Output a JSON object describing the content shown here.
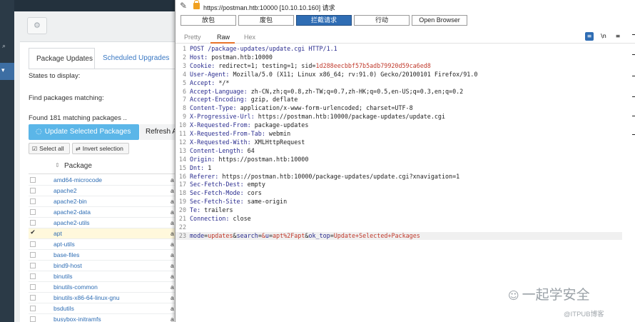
{
  "webmin": {
    "tabs": [
      "Package Updates",
      "Scheduled Upgrades"
    ],
    "states_label": "States to display:",
    "find_label": "Find packages matching:",
    "found_text": "Found 181 matching packages ..",
    "update_button": "Update Selected Packages",
    "refresh_button": "Refresh A",
    "select_all": "Select all",
    "invert_selection": "Invert selection",
    "column_header": "Package",
    "packages": [
      {
        "name": "amd64-microcode",
        "checked": false
      },
      {
        "name": "apache2",
        "checked": false
      },
      {
        "name": "apache2-bin",
        "checked": false
      },
      {
        "name": "apache2-data",
        "checked": false
      },
      {
        "name": "apache2-utils",
        "checked": false
      },
      {
        "name": "apt",
        "checked": true
      },
      {
        "name": "apt-utils",
        "checked": false
      },
      {
        "name": "base-files",
        "checked": false
      },
      {
        "name": "bind9-host",
        "checked": false
      },
      {
        "name": "binutils",
        "checked": false
      },
      {
        "name": "binutils-common",
        "checked": false
      },
      {
        "name": "binutils-x86-64-linux-gnu",
        "checked": false
      },
      {
        "name": "bsdutils",
        "checked": false
      },
      {
        "name": "busybox-initramfs",
        "checked": false
      }
    ],
    "row_tail": "a"
  },
  "burp": {
    "url": "https://postman.htb:10000  [10.10.10.160] 请求",
    "buttons": {
      "forward": "放包",
      "drop": "废包",
      "intercept": "拦截请求",
      "action": "行动",
      "open_browser": "Open Browser"
    },
    "view_tabs": [
      "Pretty",
      "Raw",
      "Hex"
    ],
    "active_view_tab": "Raw",
    "wrap_icon_label": "\\n",
    "menu_icon_label": "≡",
    "request_lines": [
      {
        "n": "1",
        "k": "POST /package-updates/update.cgi HTTP/1.1",
        "v": ""
      },
      {
        "n": "2",
        "k": "Host:",
        "v": " postman.htb:10000"
      },
      {
        "n": "3",
        "k": "Cookie:",
        "v": " redirect=1; testing=1; sid=",
        "s": "1d288eecbbf57b5adb79920d59ca6ed8"
      },
      {
        "n": "4",
        "k": "User-Agent:",
        "v": " Mozilla/5.0 (X11; Linux x86_64; rv:91.0) Gecko/20100101 Firefox/91.0"
      },
      {
        "n": "5",
        "k": "Accept:",
        "v": " */*"
      },
      {
        "n": "6",
        "k": "Accept-Language:",
        "v": " zh-CN,zh;q=0.8,zh-TW;q=0.7,zh-HK;q=0.5,en-US;q=0.3,en;q=0.2"
      },
      {
        "n": "7",
        "k": "Accept-Encoding:",
        "v": " gzip, deflate"
      },
      {
        "n": "8",
        "k": "Content-Type:",
        "v": " application/x-www-form-urlencoded; charset=UTF-8"
      },
      {
        "n": "9",
        "k": "X-Progressive-Url:",
        "v": " https://postman.htb:10000/package-updates/update.cgi"
      },
      {
        "n": "10",
        "k": "X-Requested-From:",
        "v": " package-updates"
      },
      {
        "n": "11",
        "k": "X-Requested-From-Tab:",
        "v": " webmin"
      },
      {
        "n": "12",
        "k": "X-Requested-With:",
        "v": " XMLHttpRequest"
      },
      {
        "n": "13",
        "k": "Content-Length:",
        "v": " 64"
      },
      {
        "n": "14",
        "k": "Origin:",
        "v": " https://postman.htb:10000"
      },
      {
        "n": "15",
        "k": "Dnt:",
        "v": " 1"
      },
      {
        "n": "16",
        "k": "Referer:",
        "v": " https://postman.htb:10000/package-updates/update.cgi?xnavigation=1"
      },
      {
        "n": "17",
        "k": "Sec-Fetch-Dest:",
        "v": " empty"
      },
      {
        "n": "18",
        "k": "Sec-Fetch-Mode:",
        "v": " cors"
      },
      {
        "n": "19",
        "k": "Sec-Fetch-Site:",
        "v": " same-origin"
      },
      {
        "n": "20",
        "k": "Te:",
        "v": " trailers"
      },
      {
        "n": "21",
        "k": "Connection:",
        "v": " close"
      },
      {
        "n": "22",
        "k": "",
        "v": ""
      }
    ],
    "body_line": {
      "n": "23",
      "parts": [
        {
          "t": "p",
          "text": "mode"
        },
        {
          "t": "v",
          "text": "="
        },
        {
          "t": "s",
          "text": "updates"
        },
        {
          "t": "v",
          "text": "&"
        },
        {
          "t": "p",
          "text": "search"
        },
        {
          "t": "v",
          "text": "="
        },
        {
          "t": "s",
          "text": "&"
        },
        {
          "t": "p",
          "text": "u"
        },
        {
          "t": "v",
          "text": "="
        },
        {
          "t": "s",
          "text": "apt%2Fapt"
        },
        {
          "t": "v",
          "text": "&"
        },
        {
          "t": "p",
          "text": "ok_top"
        },
        {
          "t": "v",
          "text": "="
        },
        {
          "t": "s",
          "text": "Update+Selected+Packages"
        }
      ]
    }
  },
  "watermark": {
    "main": "一起学安全",
    "sub": "@ITPUB博客"
  }
}
